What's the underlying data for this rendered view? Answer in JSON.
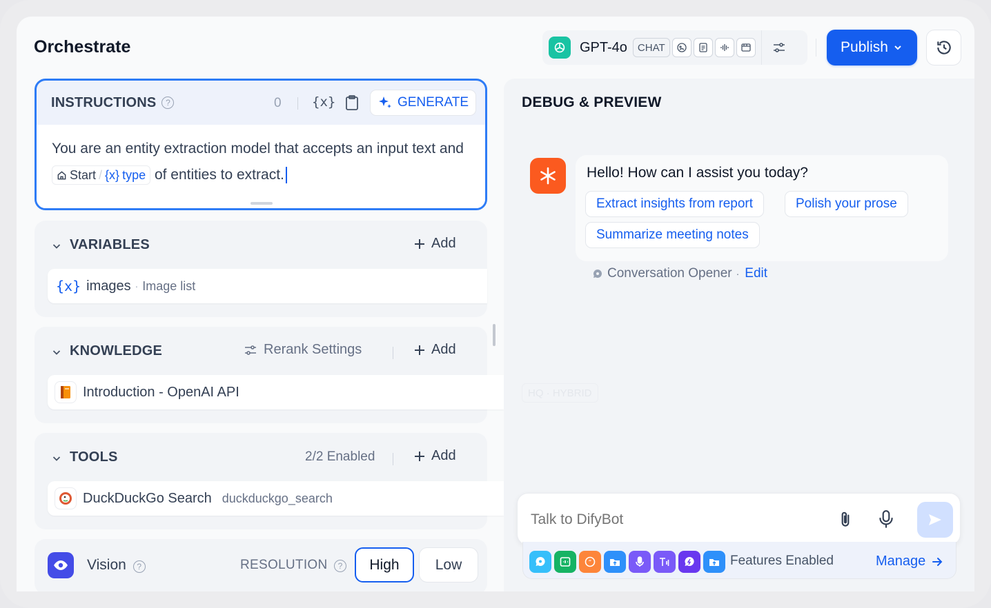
{
  "header": {
    "title": "Orchestrate",
    "model": {
      "name": "GPT-4o",
      "mode": "CHAT"
    },
    "publish_label": "Publish"
  },
  "instructions": {
    "label": "INSTRUCTIONS",
    "char_count": "0",
    "variable_icon": "{x}",
    "generate_label": "GENERATE",
    "text_before": "You are an entity extraction model that accepts an input text and",
    "chip_node": "Start",
    "chip_var_icon": "{x}",
    "chip_var": "type",
    "text_after": "of entities to extract."
  },
  "variables": {
    "label": "VARIABLES",
    "add_label": "Add",
    "items": [
      {
        "icon": "{x}",
        "name": "images",
        "separator": "·",
        "type": "Image list"
      }
    ]
  },
  "knowledge": {
    "label": "KNOWLEDGE",
    "rerank_label": "Rerank Settings",
    "add_label": "Add",
    "items": [
      {
        "name": "Introduction - OpenAI API"
      }
    ]
  },
  "tools": {
    "label": "TOOLS",
    "enabled_label": "2/2 Enabled",
    "add_label": "Add",
    "items": [
      {
        "name": "DuckDuckGo Search",
        "id": "duckduckgo_search"
      }
    ]
  },
  "vision": {
    "label": "Vision",
    "resolution_label": "RESOLUTION",
    "options": [
      "High",
      "Low"
    ],
    "selected": "High"
  },
  "debug": {
    "title": "DEBUG & PREVIEW",
    "greeting": "Hello! How can I assist you today?",
    "suggestions": [
      "Extract insights from report",
      "Polish your prose",
      "Summarize meeting notes"
    ],
    "opener_label": "Conversation Opener",
    "opener_sep": "·",
    "edit_label": "Edit",
    "faint_tag": "HQ · HYBRID",
    "input_placeholder": "Talk to DifyBot",
    "features_label": "Features Enabled",
    "manage_label": "Manage"
  },
  "colors": {
    "accent": "#155eef",
    "instructions_border": "#2e7cf6",
    "bot_avatar": "#fb5a1f",
    "model_logo": "#19c3a3",
    "vision_icon": "#444ce7"
  },
  "feature_icons": [
    "opener-icon",
    "follow-up-icon",
    "citation-icon",
    "file-upload-icon",
    "speech-to-text-icon",
    "text-to-speech-icon",
    "moderation-icon",
    "upload-icon"
  ]
}
